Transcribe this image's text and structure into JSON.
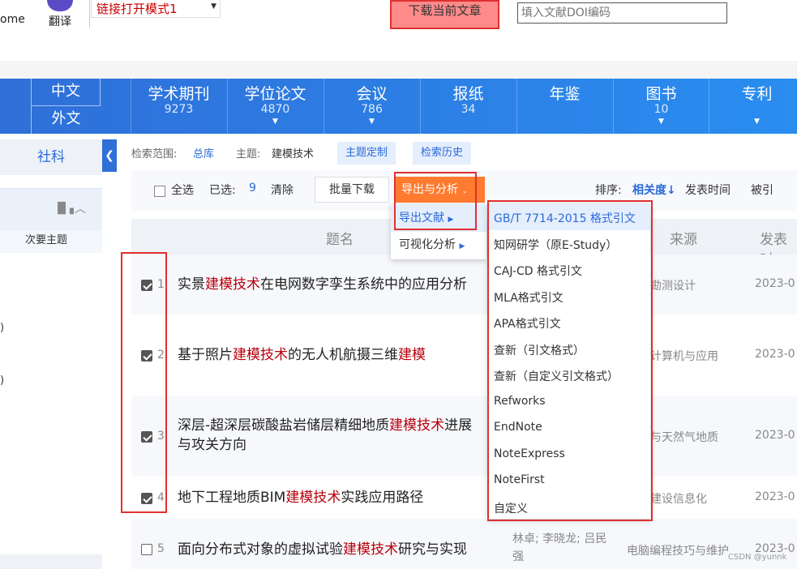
{
  "toolbar_top": {
    "home_label": "ome",
    "translate_label": "翻译",
    "mode_select_value": "链接打开模式1",
    "download_button": "下载当前文章",
    "doi_placeholder": "填入文献DOI编码"
  },
  "lang_tabs": [
    "中文",
    "外文"
  ],
  "databases": [
    {
      "name": "学术期刊",
      "count": "9273"
    },
    {
      "name": "学位论文",
      "count": "4870"
    },
    {
      "name": "会议",
      "count": "786"
    },
    {
      "name": "报纸",
      "count": "34"
    },
    {
      "name": "年鉴",
      "count": ""
    },
    {
      "name": "图书",
      "count": "10"
    },
    {
      "name": "专利",
      "count": ""
    }
  ],
  "sidebar": {
    "tab_label": "社科",
    "sub_label": "次要主题",
    "paren1": ")",
    "paren2": ")"
  },
  "scope": {
    "range_label": "检索范围:",
    "range_value": "总库",
    "topic_label": "主题:",
    "topic_value": "建模技术",
    "topic_custom_button": "主题定制",
    "history_button": "检索历史"
  },
  "results_toolbar": {
    "select_all": "全选",
    "selected_label": "已选:",
    "selected_count": "9",
    "clear": "清除",
    "batch_download": "批量下载",
    "export_analysis": "导出与分析",
    "sort_label": "排序:",
    "sort_relevance": "相关度",
    "sort_date": "发表时间",
    "sort_cited": "被引"
  },
  "table_headers": {
    "title": "题名",
    "source": "来源",
    "date": "发表时"
  },
  "rows": [
    {
      "num": "1",
      "checked": true,
      "title_pre": "实景",
      "title_hl": "建模技术",
      "title_post": "在电网数字孪生系统中的应用分析",
      "source": "勘测设计",
      "date": "2023-0"
    },
    {
      "num": "2",
      "checked": true,
      "title_pre": "基于照片",
      "title_hl": "建模技术",
      "title_post": "的无人机航摄三维",
      "title_hl2": "建模",
      "source": "计算机与应用",
      "date": "2023-0"
    },
    {
      "num": "3",
      "checked": true,
      "title_pre": "深层-超深层碳酸盐岩储层精细地质",
      "title_hl": "建模技术",
      "title_post": "进展",
      "title_line2": "与攻关方向",
      "source": "与天然气地质",
      "date": "2023-0"
    },
    {
      "num": "4",
      "checked": true,
      "title_pre": "地下工程地质BIM",
      "title_hl": "建模技术",
      "title_post": "实践应用路径",
      "source": "建设信息化",
      "date": "2023-0"
    },
    {
      "num": "5",
      "checked": false,
      "title_pre": "面向分布式对象的虚拟试验",
      "title_hl": "建模技术",
      "title_post": "研究与实现",
      "authors_line1": "林卓; 李晓龙; 吕民",
      "authors_line2": "强",
      "source": "电脑编程技巧与维护",
      "date": "2023-0"
    }
  ],
  "export_menu": {
    "export_refs": "导出文献",
    "visual_analysis": "可视化分析"
  },
  "citation_formats": [
    "GB/T 7714-2015 格式引文",
    "知网研学（原E-Study）",
    "CAJ-CD 格式引文",
    "MLA格式引文",
    "APA格式引文",
    "查新（引文格式）",
    "查新（自定义引文格式）",
    "Refworks",
    "EndNote",
    "NoteExpress",
    "NoteFirst",
    "自定义"
  ],
  "watermark": "CSDN @yunnk"
}
